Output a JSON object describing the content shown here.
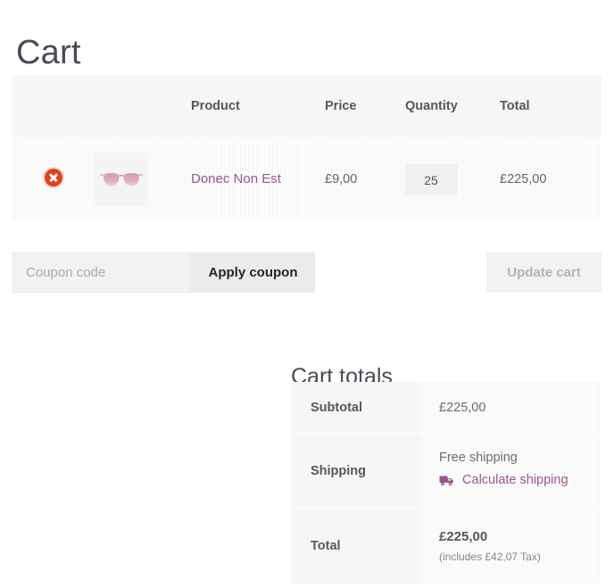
{
  "page": {
    "title": "Cart"
  },
  "cart_table": {
    "headers": {
      "remove": "",
      "thumbnail": "",
      "product": "Product",
      "price": "Price",
      "quantity": "Quantity",
      "total": "Total"
    },
    "rows": [
      {
        "remove_label": "×",
        "thumbnail_icon": "sunglasses-thumbnail",
        "product_name": "Donec Non Est",
        "price": "£9,00",
        "quantity": "25",
        "total": "£225,00"
      }
    ]
  },
  "actions": {
    "coupon_placeholder": "Coupon code",
    "coupon_value": "",
    "apply_label": "Apply coupon",
    "update_label": "Update cart"
  },
  "cart_totals": {
    "heading": "Cart totals",
    "subtotal_label": "Subtotal",
    "subtotal_value": "£225,00",
    "shipping_label": "Shipping",
    "shipping_method": "Free shipping",
    "calculate_shipping_label": "Calculate shipping",
    "total_label": "Total",
    "total_value": "£225,00",
    "tax_note": "(includes £42,07 Tax)"
  },
  "colors": {
    "link": "#96588a",
    "remove_button": "#e2401c",
    "heading": "#4a4a55",
    "panel_bg": "#f6f6f6",
    "text": "#6b6b70"
  }
}
